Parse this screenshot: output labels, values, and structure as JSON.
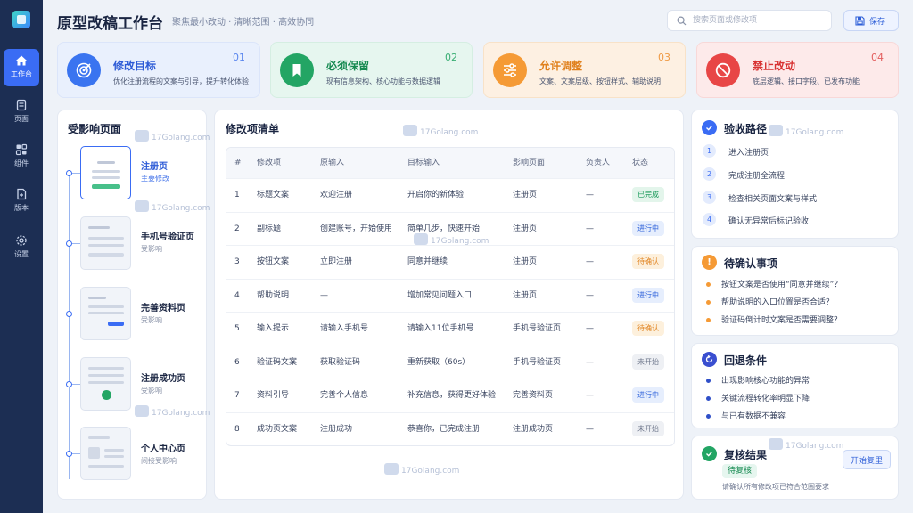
{
  "app": {
    "title": "原型改稿工作台",
    "subtitle": "聚焦最小改动 · 清晰范围 · 高效协同"
  },
  "nav": [
    {
      "label": "工作台",
      "icon": "home-icon",
      "active": true
    },
    {
      "label": "页面",
      "icon": "page-icon"
    },
    {
      "label": "组件",
      "icon": "component-icon"
    },
    {
      "label": "版本",
      "icon": "version-icon"
    },
    {
      "label": "设置",
      "icon": "settings-icon"
    }
  ],
  "search": {
    "placeholder": "搜索页面或修改项",
    "value": ""
  },
  "toolbar": {
    "save_label": "保存"
  },
  "cards": [
    {
      "num": "01",
      "title": "修改目标",
      "desc": "优化注册流程的文案与引导，提升转化体验",
      "icon": "target-icon"
    },
    {
      "num": "02",
      "title": "必须保留",
      "desc": "现有信息架构、核心功能与数据逻辑",
      "icon": "bookmark-icon"
    },
    {
      "num": "03",
      "title": "允许调整",
      "desc": "文案、文案层级、按钮样式、辅助说明",
      "icon": "sliders-icon"
    },
    {
      "num": "04",
      "title": "禁止改动",
      "desc": "底层逻辑、接口字段、已发布功能",
      "icon": "ban-icon"
    }
  ],
  "affected": {
    "title": "受影响页面",
    "items": [
      {
        "name": "注册页",
        "sub": "主要修改"
      },
      {
        "name": "手机号验证页",
        "sub": "受影响"
      },
      {
        "name": "完善资料页",
        "sub": "受影响"
      },
      {
        "name": "注册成功页",
        "sub": "受影响"
      },
      {
        "name": "个人中心页",
        "sub": "间接受影响"
      }
    ]
  },
  "changes": {
    "title": "修改项清单",
    "columns": [
      "#",
      "修改项",
      "原输入",
      "目标输入",
      "影响页面",
      "负责人",
      "状态"
    ],
    "rows": [
      [
        "1",
        "标题文案",
        "欢迎注册",
        "开启你的新体验",
        "注册页",
        "—",
        "已完成"
      ],
      [
        "2",
        "副标题",
        "创建账号，开始使用",
        "简单几步，快速开始",
        "注册页",
        "—",
        "进行中"
      ],
      [
        "3",
        "按钮文案",
        "立即注册",
        "同意并继续",
        "注册页",
        "—",
        "待确认"
      ],
      [
        "4",
        "帮助说明",
        "—",
        "增加常见问题入口",
        "注册页",
        "—",
        "进行中"
      ],
      [
        "5",
        "输入提示",
        "请输入手机号",
        "请输入11位手机号",
        "手机号验证页",
        "—",
        "待确认"
      ],
      [
        "6",
        "验证码文案",
        "获取验证码",
        "重新获取（60s）",
        "手机号验证页",
        "—",
        "未开始"
      ],
      [
        "7",
        "资料引导",
        "完善个人信息",
        "补充信息，获得更好体验",
        "完善资料页",
        "—",
        "进行中"
      ],
      [
        "8",
        "成功页文案",
        "注册成功",
        "恭喜你，已完成注册",
        "注册成功页",
        "—",
        "未开始"
      ]
    ],
    "status_colors": {
      "已完成": {
        "bg": "#e3f5eb",
        "fg": "#1a9a5a"
      },
      "进行中": {
        "bg": "#e6eefd",
        "fg": "#2f62da"
      },
      "待确认": {
        "bg": "#fdf0dc",
        "fg": "#e0821e"
      },
      "未开始": {
        "bg": "#eef0f4",
        "fg": "#6a7388"
      }
    }
  },
  "verify": {
    "title": "验收路径",
    "steps": [
      "进入注册页",
      "完成注册全流程",
      "检查相关页面文案与样式",
      "确认无异常后标记验收"
    ]
  },
  "pending": {
    "title": "待确认事项",
    "items": [
      "按钮文案是否使用“同意并继续”？",
      "帮助说明的入口位置是否合适？",
      "验证码倒计时文案是否需要调整？"
    ]
  },
  "rollback": {
    "title": "回退条件",
    "items": [
      "出现影响核心功能的异常",
      "关键流程转化率明显下降",
      "与已有数据不兼容"
    ]
  },
  "review": {
    "title": "复核结果",
    "status": "待复核",
    "note": "请确认所有修改项已符合范围要求",
    "button": "开始复里"
  },
  "watermark": "17Golang.com",
  "colors": {
    "accent": "#3a6cf4",
    "sidebar": "#1c2e53",
    "success": "#23a564",
    "warning": "#f59a35",
    "danger": "#e84646"
  }
}
